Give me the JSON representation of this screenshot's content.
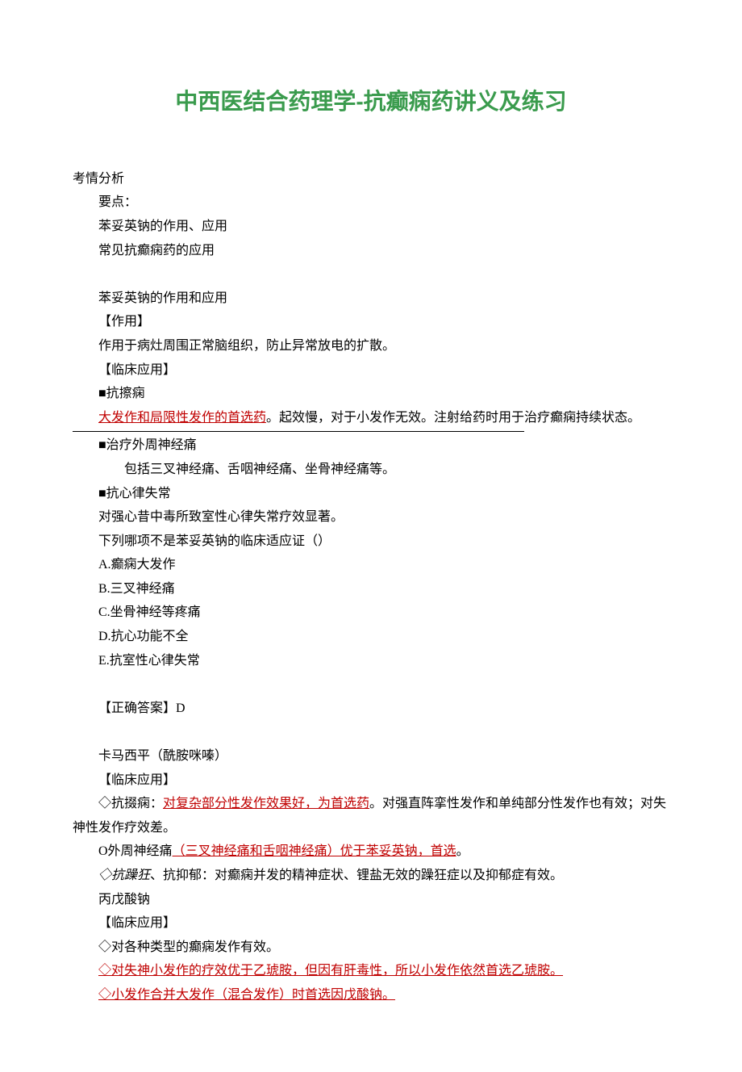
{
  "title": "中西医结合药理学-抗癫痫药讲义及练习",
  "sec1": {
    "h": "考情分析",
    "p1": "要点：",
    "p2": "苯妥英钠的作用、应用",
    "p3": "常见抗癫痫药的应用"
  },
  "sec2": {
    "p1": "苯妥英钠的作用和应用",
    "p2": "【作用】",
    "p3": "作用于病灶周围正常脑组织，防止异常放电的扩散。",
    "p4": "【临床应用】",
    "p5": "■抗擦痫",
    "p6a": "大发作和局限性发作的首选药",
    "p6b": "。起效慢，对于小发作无效。注射给药时用于治疗癫痫持续状态。",
    "p7": "■治疗外周神经痛",
    "p8": "包括三叉神经痛、舌咽神经痛、坐骨神经痛等。",
    "p9": "■抗心律失常",
    "p10": "对强心昔中毒所致室性心律失常疗效显著。"
  },
  "q1": {
    "stem": "下列哪项不是苯妥英钠的临床适应证（）",
    "a": "A.癫痫大发作",
    "b": "B.三叉神经痛",
    "c": "C.坐骨神经等疼痛",
    "d": "D.抗心功能不全",
    "e": "E.抗室性心律失常",
    "ans": "【正确答案】D"
  },
  "sec3": {
    "p1": "卡马西平（酰胺咪嗪）",
    "p2": "【临床应用】",
    "p3a": "◇抗掇痫：",
    "p3b": "对复杂部分性发作效果好，为首选药",
    "p3c": "。对强直阵挛性发作和单纯部分性发作也有效；对失神性发作疗效差。",
    "p4a": "O外周神经痛",
    "p4b": "（三叉神经痛和舌咽神经痛）优于苯妥英钠，首选",
    "p4c": "。",
    "p5": "◇抗躁狂、抗抑郁：对癫痫并发的精神症状、锂盐无效的躁狂症以及抑郁症有效。"
  },
  "sec4": {
    "p1": "丙戊酸钠",
    "p2": "【临床应用】",
    "p3": "◇对各种类型的癫痫发作有效。",
    "p4": "◇对失神小发作的疗效优于乙琥胺，但因有肝毒性，所以小发作依然首选乙琥胺。",
    "p5": "◇小发作合并大发作（混合发作）时首选因戊酸钠。 "
  }
}
